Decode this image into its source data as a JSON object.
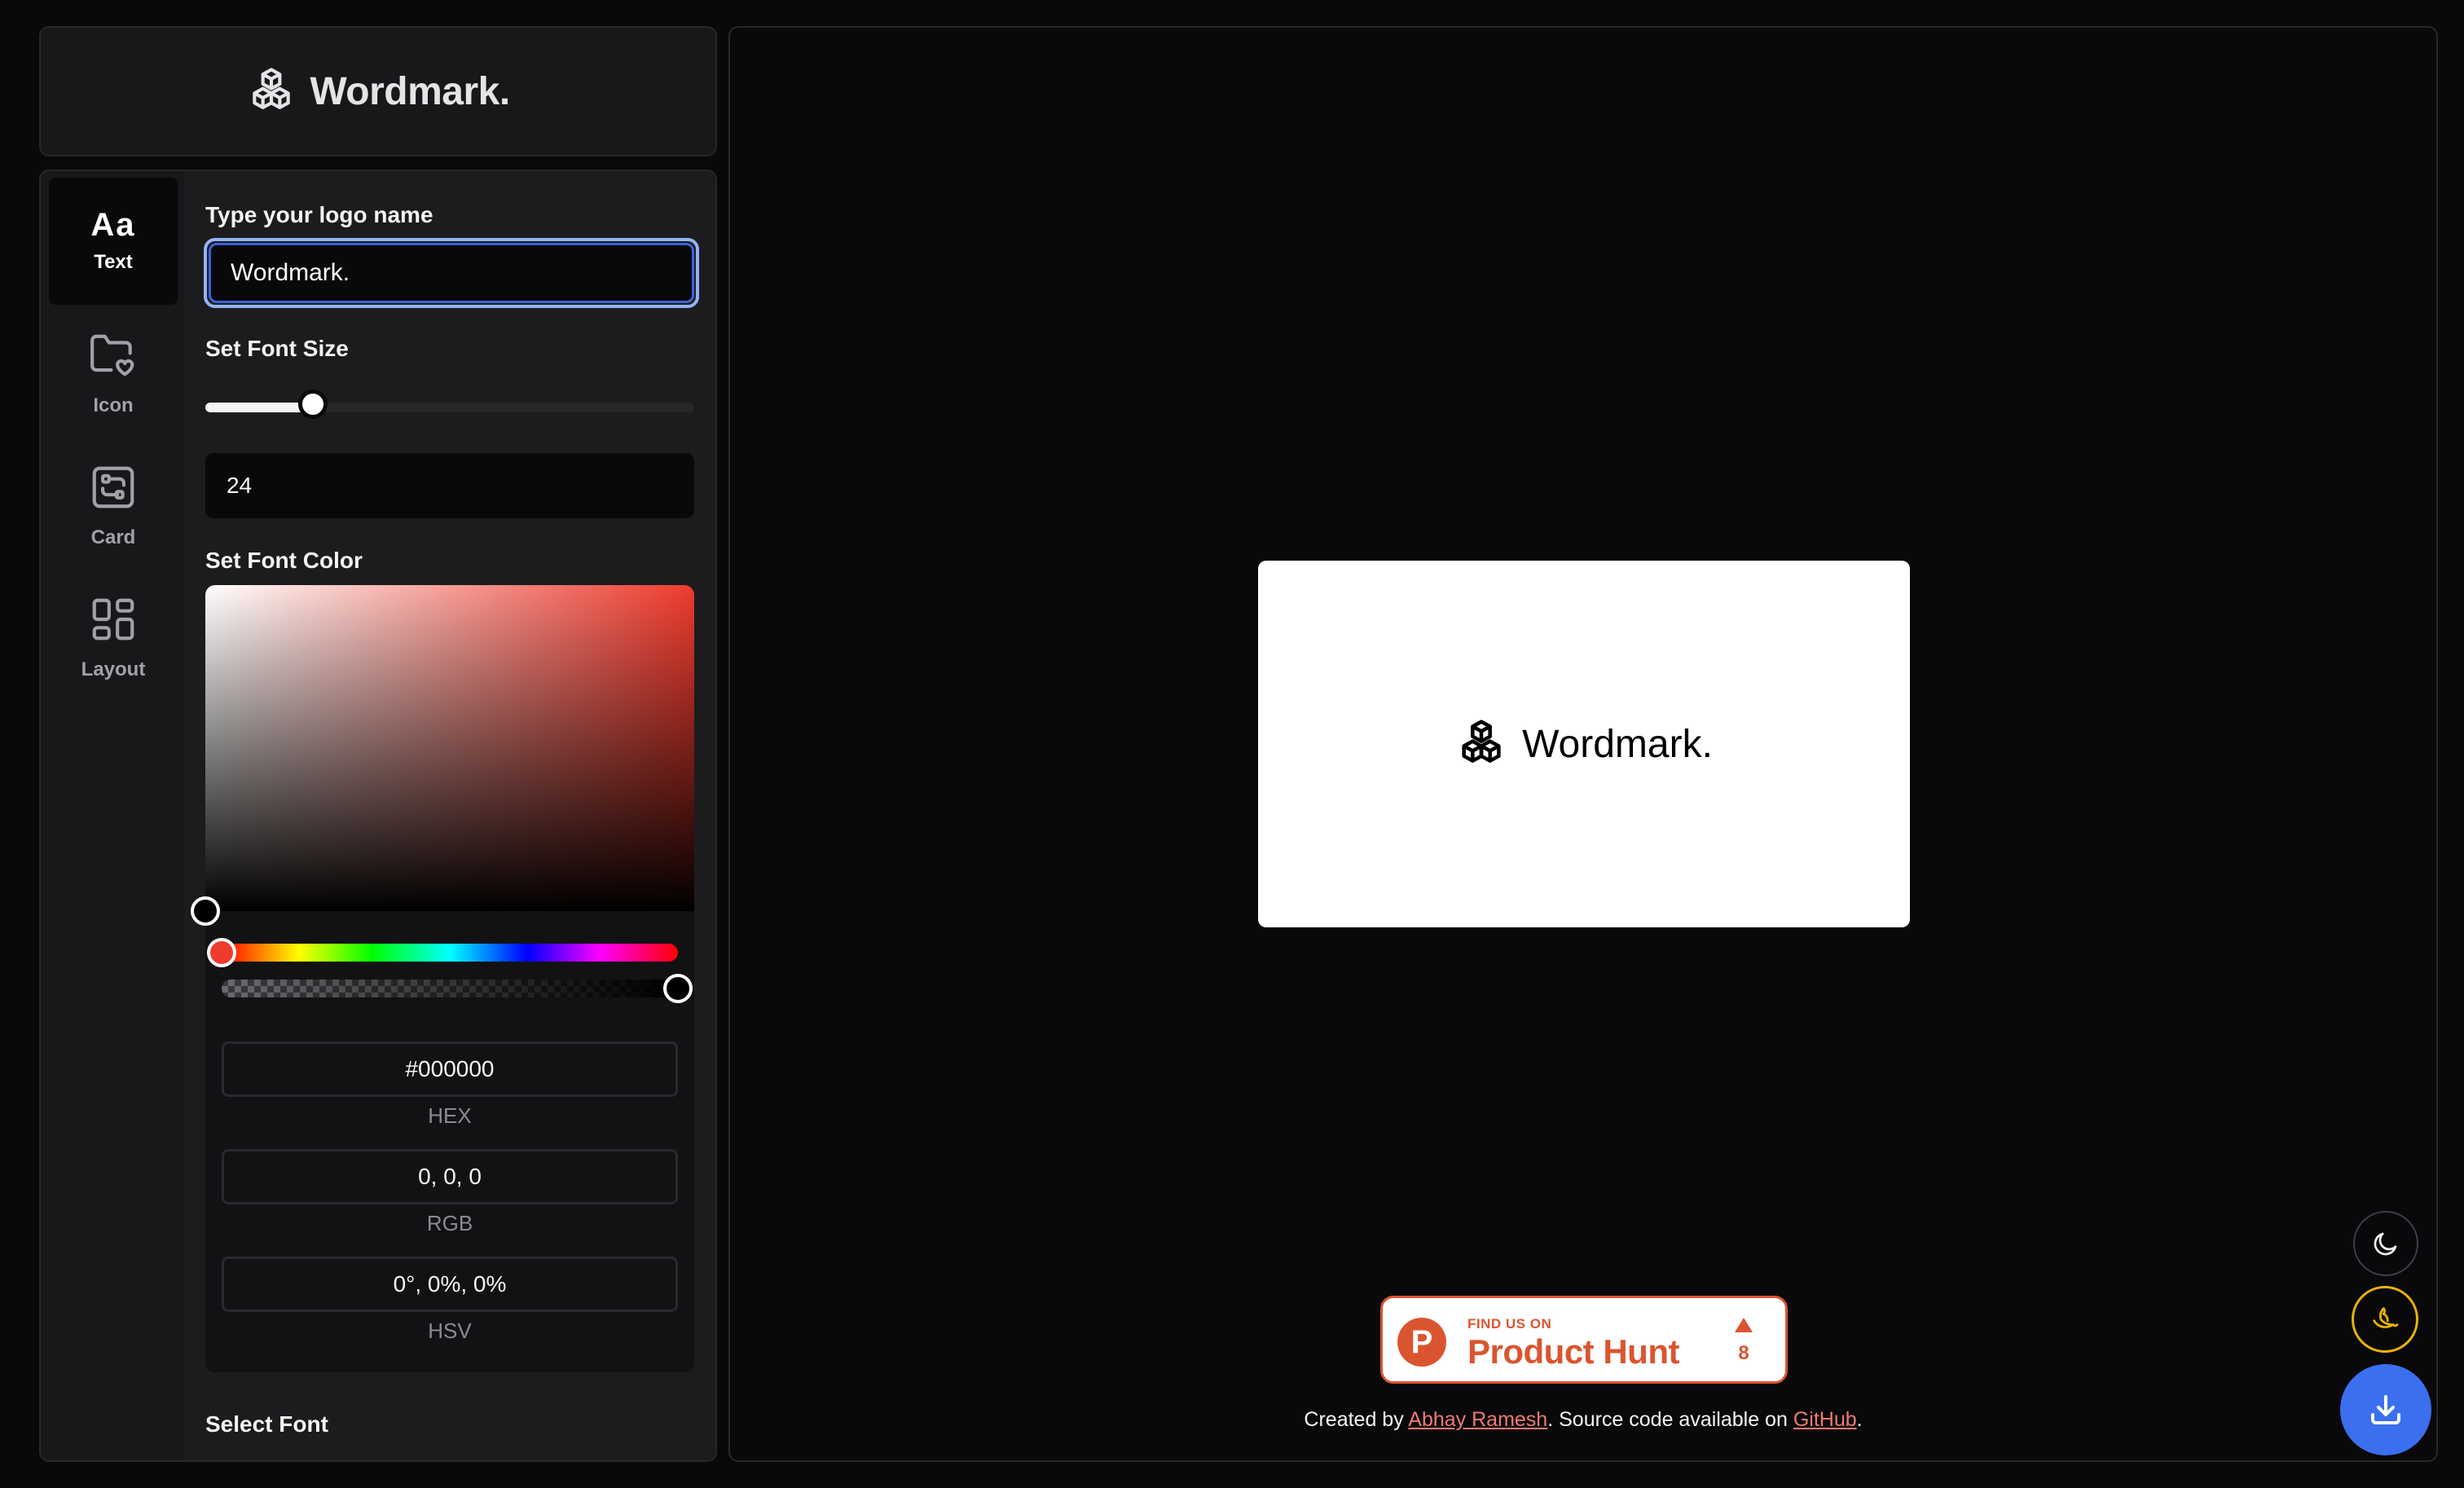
{
  "brand": {
    "title": "Wordmark.",
    "icon": "cubes-icon"
  },
  "tabs": [
    {
      "label": "Text",
      "icon": "aa-text-icon",
      "glyph": "Aa",
      "active": true
    },
    {
      "label": "Icon",
      "icon": "folder-heart-icon",
      "active": false
    },
    {
      "label": "Card",
      "icon": "card-icon",
      "active": false
    },
    {
      "label": "Layout",
      "icon": "layout-grid-icon",
      "active": false
    }
  ],
  "text_settings": {
    "name_label": "Type your logo name",
    "name_value": "Wordmark.",
    "font_size_label": "Set Font Size",
    "font_size_value": "24",
    "font_size_slider_fraction": 0.22,
    "font_color_label": "Set Font Color",
    "select_font_label": "Select Font"
  },
  "color_picker": {
    "hue_color": "#ef3b2e",
    "hue_fraction": 0.0,
    "alpha_fraction": 1.0,
    "hex_value": "#000000",
    "hex_caption": "HEX",
    "rgb_value": "0, 0, 0",
    "rgb_caption": "RGB",
    "hsv_value": "0°, 0%, 0%",
    "hsv_caption": "HSV"
  },
  "preview": {
    "logo_text": "Wordmark.",
    "logo_icon": "cubes-icon",
    "card_color": "#ffffff",
    "text_color": "#000000"
  },
  "product_hunt": {
    "small_text": "FIND US ON",
    "big_text": "Product Hunt",
    "letter": "P",
    "upvotes": "8",
    "color": "#da552f"
  },
  "credits": {
    "prefix": "Created by ",
    "author": "Abhay Ramesh",
    "middle": ". Source code available on ",
    "repo": "GitHub",
    "suffix": "."
  },
  "floating_buttons": {
    "theme_icon": "moon-icon",
    "banana_icon": "banana-icon",
    "download_icon": "download-icon",
    "download_color": "#3b6ff0"
  }
}
